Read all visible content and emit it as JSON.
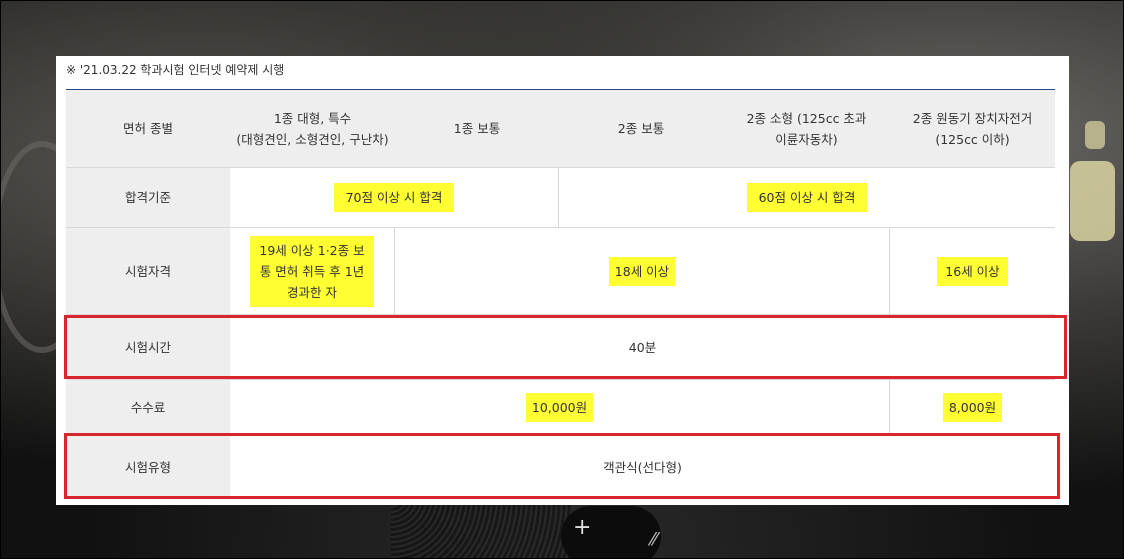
{
  "notice": "※ '21.03.22 학과시험 인터넷 예약제 시행",
  "header": {
    "type_label": "면허 종별",
    "columns": [
      "1종 대형, 특수\n(대형견인, 소형견인, 구난차)",
      "1종 보통",
      "2종 보통",
      "2종 소형 (125cc 초과\n이륜자동차)",
      "2종 원동기 장치자전거\n(125cc 이하)"
    ]
  },
  "rows": {
    "pass": {
      "label": "합격기준",
      "group1": "70점 이상 시 합격",
      "group2": "60점 이상 시 합격"
    },
    "eligibility": {
      "label": "시험자격",
      "col1": "19세 이상 1·2종 보통 면허 취득 후 1년 경과한 자",
      "mid": "18세 이상",
      "last": "16세 이상"
    },
    "time": {
      "label": "시험시간",
      "value": "40분"
    },
    "fee": {
      "label": "수수료",
      "main": "10,000원",
      "last": "8,000원"
    },
    "type": {
      "label": "시험유형",
      "value": "객관식(선다형)"
    }
  },
  "colors": {
    "highlight": "#ffff33",
    "redbox": "#d8262c",
    "header_bg": "#eeeeee",
    "topline": "#1f4e8c"
  }
}
